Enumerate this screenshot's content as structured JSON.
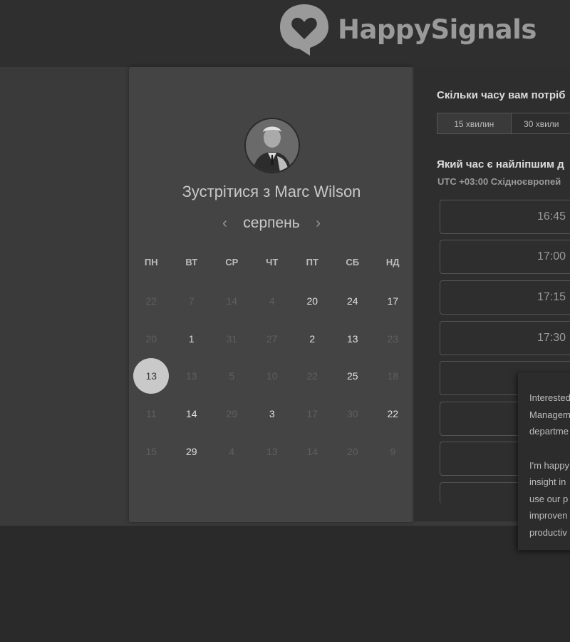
{
  "brand": {
    "name": "HappySignals",
    "logo_icon": "heart-speech-bubble-icon"
  },
  "host": {
    "meet_title": "Зустрітися з Marc Wilson",
    "avatar_icon": "avatar-photo"
  },
  "calendar": {
    "month": "серпень",
    "prev_icon": "chevron-left-icon",
    "next_icon": "chevron-right-icon",
    "weekdays": [
      "ПН",
      "ВТ",
      "СР",
      "ЧТ",
      "ПТ",
      "СБ",
      "НД"
    ],
    "weeks": [
      [
        "22",
        "7",
        "14",
        "4",
        "20",
        "24",
        "17"
      ],
      [
        "20",
        "1",
        "31",
        "27",
        "2",
        "13",
        "23"
      ],
      [
        "13",
        "13",
        "5",
        "10",
        "22",
        "25",
        "18"
      ],
      [
        "11",
        "14",
        "29",
        "3",
        "17",
        "30",
        "22"
      ],
      [
        "15",
        "29",
        "4",
        "13",
        "14",
        "20",
        "9"
      ]
    ],
    "selected_day": "13"
  },
  "scheduler": {
    "duration_question": "Скільки часу вам потріб",
    "duration_options": [
      "15 хвилин",
      "30 хвили"
    ],
    "time_question": "Який час є найліпшим д",
    "timezone": "UTC +03:00 Східноєвропей",
    "slots": [
      "16:45",
      "17:00",
      "17:15",
      "17:30"
    ]
  },
  "popup": {
    "lines1": [
      "Interested",
      "Managem",
      "departme"
    ],
    "lines2": [
      "I'm happy",
      "insight in",
      "use our p",
      "improven",
      "productiv"
    ]
  },
  "colors": {
    "selected_day_bg": "#c9c9c9",
    "card_bg": "#444444"
  }
}
